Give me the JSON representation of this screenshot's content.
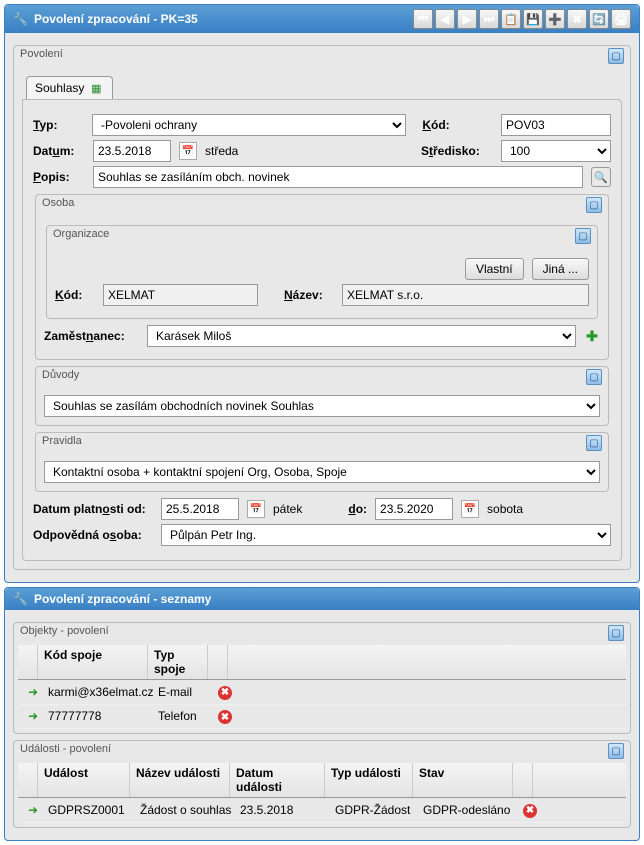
{
  "header": {
    "title": "Povolení zpracování - PK=35"
  },
  "section_main": {
    "title": "Povolení"
  },
  "tab": {
    "label": "Souhlasy"
  },
  "fields": {
    "typ_label": "Typ:",
    "typ_value": "-Povoleni ochrany",
    "kod_label": "Kód:",
    "kod_value": "POV03",
    "datum_label": "Datum:",
    "datum_value": "23.5.2018",
    "datum_day": "středa",
    "stredisko_label": "Středisko:",
    "stredisko_value": "100",
    "popis_label": "Popis:",
    "popis_value": "Souhlas se zasíláním obch. novinek"
  },
  "osoba": {
    "title": "Osoba",
    "org_title": "Organizace",
    "btn_vlastni": "Vlastní",
    "btn_jina": "Jiná ...",
    "kod_label": "Kód:",
    "kod_value": "XELMAT",
    "nazev_label": "Název:",
    "nazev_value": "XELMAT s.r.o.",
    "zam_label": "Zaměstnanec:",
    "zam_value": "Karásek Miloš"
  },
  "duvody": {
    "title": "Důvody",
    "value": "Souhlas se zasílám obchodních novinek Souhlas"
  },
  "pravidla": {
    "title": "Pravidla",
    "value": "Kontaktní osoba + kontaktní spojení Org, Osoba, Spoje"
  },
  "platnost": {
    "od_label": "Datum platnosti od:",
    "od_value": "25.5.2018",
    "od_day": "pátek",
    "do_label": "do:",
    "do_value": "23.5.2020",
    "do_day": "sobota",
    "odp_label": "Odpovědná osoba:",
    "odp_value": "Půlpán Petr Ing."
  },
  "panel2": {
    "title": "Povolení zpracování - seznamy"
  },
  "objekty": {
    "title": "Objekty - povolení",
    "h1": "Kód spoje",
    "h2": "Typ spoje",
    "rows": [
      {
        "kod": "karmi@x36elmat.cz",
        "typ": "E-mail"
      },
      {
        "kod": "77777778",
        "typ": "Telefon"
      }
    ]
  },
  "udalosti": {
    "title": "Události - povolení",
    "h1": "Událost",
    "h2": "Název události",
    "h3": "Datum události",
    "h4": "Typ události",
    "h5": "Stav",
    "rows": [
      {
        "u": "GDPRSZ0001",
        "n": "Žádost o souhlas",
        "d": "23.5.2018",
        "t": "GDPR-Žádost",
        "s": "GDPR-odesláno"
      }
    ]
  }
}
